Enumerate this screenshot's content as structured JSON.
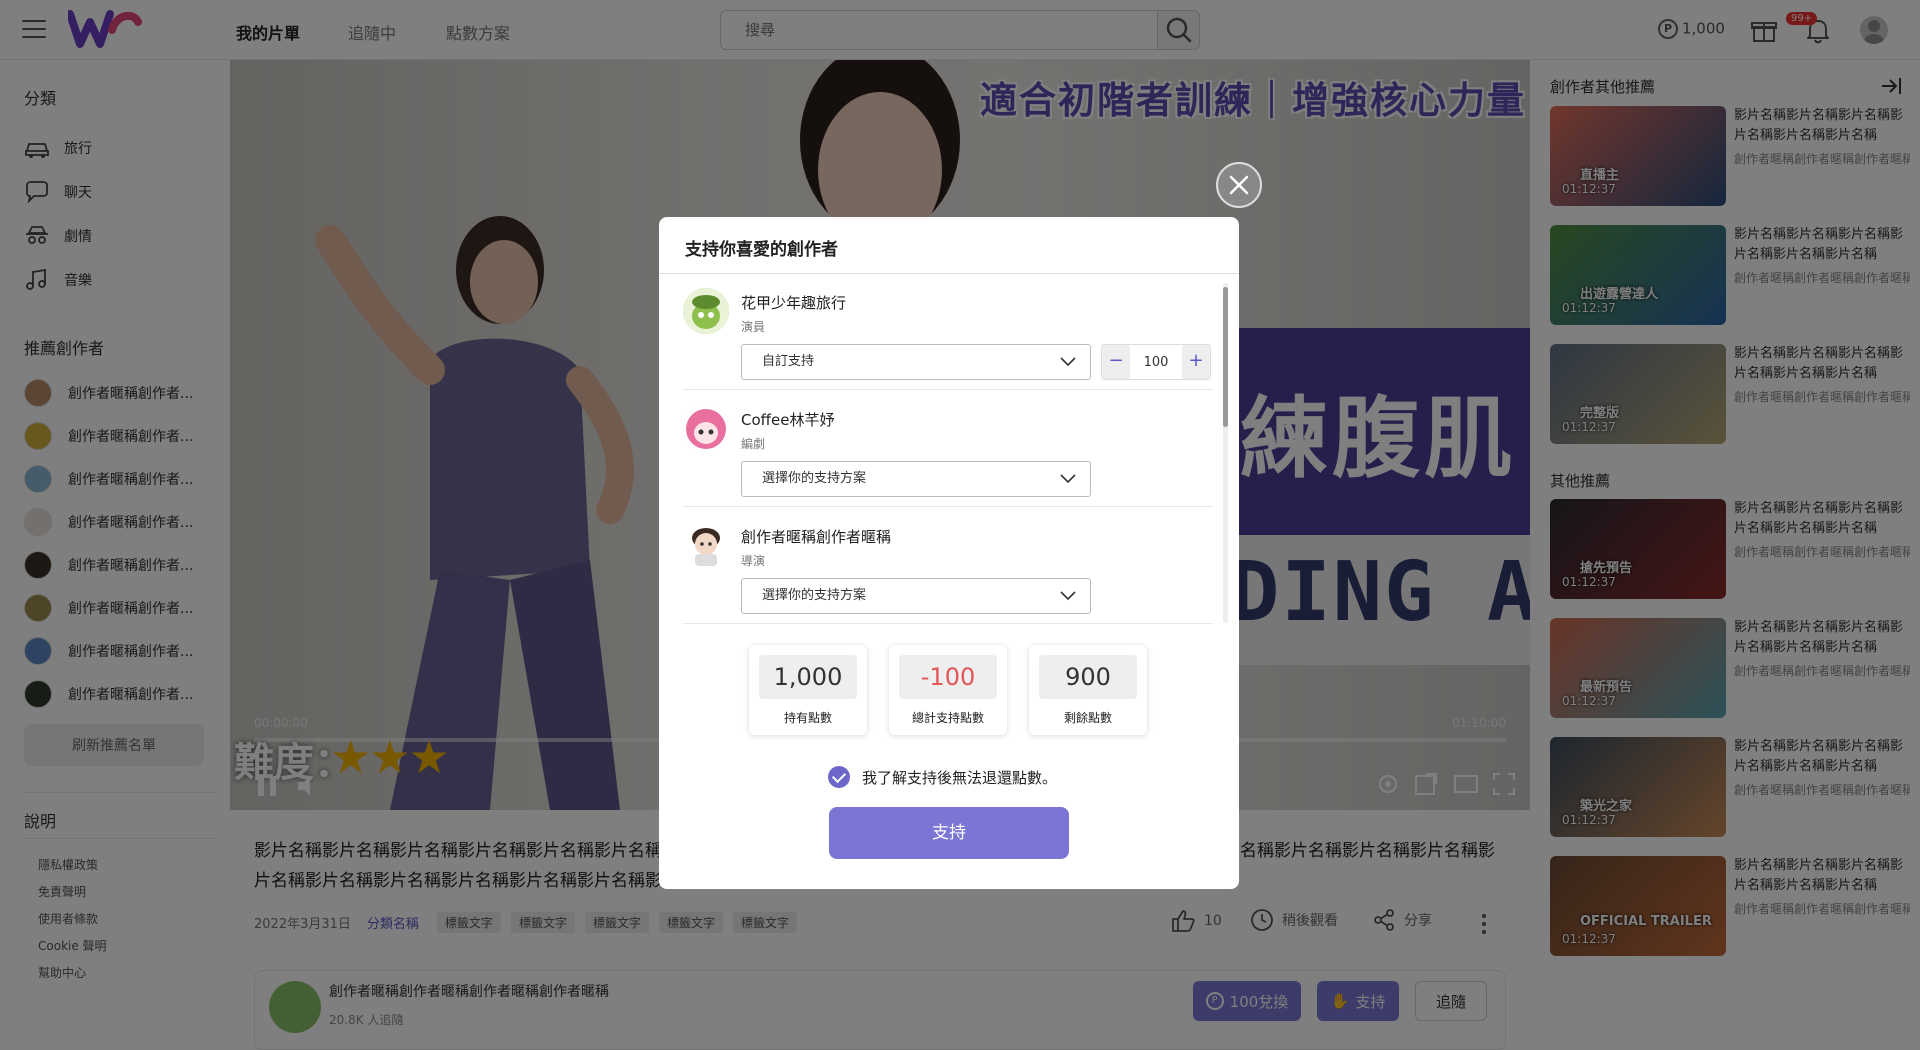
{
  "header": {
    "nav": [
      "我的片單",
      "追隨中",
      "點數方案"
    ],
    "search_placeholder": "搜尋",
    "points": "1,000",
    "notification_badge": "99+"
  },
  "sidebar": {
    "categories_heading": "分類",
    "categories": [
      {
        "label": "旅行",
        "icon": "car-icon"
      },
      {
        "label": "聊天",
        "icon": "chat-icon"
      },
      {
        "label": "劇情",
        "icon": "spy-icon"
      },
      {
        "label": "音樂",
        "icon": "music-icon"
      }
    ],
    "creators_heading": "推薦創作者",
    "creators": [
      "創作者暱稱創作者...",
      "創作者暱稱創作者...",
      "創作者暱稱創作者...",
      "創作者暱稱創作者...",
      "創作者暱稱創作者...",
      "創作者暱稱創作者...",
      "創作者暱稱創作者...",
      "創作者暱稱創作者..."
    ],
    "refresh_label": "刷新推薦名單",
    "info_heading": "說明",
    "links": [
      "隱私權政策",
      "免責聲明",
      "使用者條款",
      "Cookie 聲明",
      "幫助中心"
    ]
  },
  "player": {
    "overlay_title": "適合初階者訓練｜增強核心力量",
    "overlay_cn": "練腹肌",
    "overlay_en": "DING ABS",
    "difficulty_label": "難度：",
    "difficulty_stars": 3,
    "time_current": "00:00:00",
    "time_total": "01:10:00"
  },
  "video": {
    "title": "影片名稱影片名稱影片名稱影片名稱影片名稱影片名稱影片名稱影片名稱影片名稱影片名稱影片名稱影片名稱影片名稱影片名稱影片名稱影片名稱影片名稱影片名稱影片名稱影片名稱影片名稱影片名稱影片名稱影片名稱影片名稱影片名稱影片名稱影片名稱影片名稱影片名稱",
    "date": "2022年3月31日",
    "category": "分類名稱",
    "tags": [
      "標籤文字",
      "標籤文字",
      "標籤文字",
      "標籤文字",
      "標籤文字"
    ],
    "likes": "10",
    "watch_later": "稍後觀看",
    "share": "分享"
  },
  "creator_card": {
    "name": "創作者暱稱創作者暱稱創作者暱稱創作者暱稱",
    "followers": "20.8K 人追隨",
    "redeem_label": "100兌換",
    "support_label": "支持",
    "follow_label": "追隨"
  },
  "right_column": {
    "creator_heading": "創作者其他推薦",
    "other_heading": "其他推薦",
    "items": [
      {
        "title": "影片名稱影片名稱影片名稱影片名稱影片名稱影片名稱",
        "sub": "創作者暱稱創作者暱稱創作者暱稱",
        "duration": "01:12:37",
        "color1": "#e46d5b",
        "color2": "#2b4d7a",
        "caption": "直播主"
      },
      {
        "title": "影片名稱影片名稱影片名稱影片名稱影片名稱影片名稱",
        "sub": "創作者暱稱創作者暱稱創作者暱稱",
        "duration": "01:12:37",
        "color1": "#4f8f3f",
        "color2": "#2f65a8",
        "caption": "出遊露營達人"
      },
      {
        "title": "影片名稱影片名稱影片名稱影片名稱影片名稱影片名稱",
        "sub": "創作者暱稱創作者暱稱創作者暱稱",
        "duration": "01:12:37",
        "color1": "#5f6f86",
        "color2": "#b4a676",
        "caption": "完整版"
      },
      {
        "title": "影片名稱影片名稱影片名稱影片名稱影片名稱影片名稱",
        "sub": "創作者暱稱創作者暱稱創作者暱稱",
        "duration": "01:12:37",
        "color1": "#2c2b33",
        "color2": "#8b2a2a",
        "caption": "搶先預告"
      },
      {
        "title": "影片名稱影片名稱影片名稱影片名稱影片名稱影片名稱",
        "sub": "創作者暱稱創作者暱稱創作者暱稱",
        "duration": "01:12:37",
        "color1": "#d1694f",
        "color2": "#59a4b1",
        "caption": "最新預告"
      },
      {
        "title": "影片名稱影片名稱影片名稱影片名稱影片名稱影片名稱",
        "sub": "創作者暱稱創作者暱稱創作者暱稱",
        "duration": "01:12:37",
        "color1": "#3c4d5e",
        "color2": "#c98a55",
        "caption": "築光之家"
      },
      {
        "title": "影片名稱影片名稱影片名稱影片名稱影片名稱影片名稱",
        "sub": "創作者暱稱創作者暱稱創作者暱稱",
        "duration": "01:12:37",
        "color1": "#6b4a33",
        "color2": "#c26a3a",
        "caption": "OFFICIAL TRAILER"
      }
    ]
  },
  "modal": {
    "title": "支持你喜愛的創作者",
    "creators": [
      {
        "name": "花甲少年趣旅行",
        "role": "演員",
        "plan": "自訂支持",
        "amount": "100"
      },
      {
        "name": "Coffee林芊妤",
        "role": "編劇",
        "plan": "選擇你的支持方案"
      },
      {
        "name": "創作者暱稱創作者暱稱",
        "role": "導演",
        "plan": "選擇你的支持方案"
      }
    ],
    "points": [
      {
        "value": "1,000",
        "label": "持有點數"
      },
      {
        "value": "-100",
        "label": "總計支持點數"
      },
      {
        "value": "900",
        "label": "剩餘點數"
      }
    ],
    "ack_label": "我了解支持後無法退還點數。",
    "submit_label": "支持"
  },
  "colors": {
    "accent": "#6d67c9",
    "negative": "#e45555",
    "brand_purple": "#5b3fae"
  }
}
